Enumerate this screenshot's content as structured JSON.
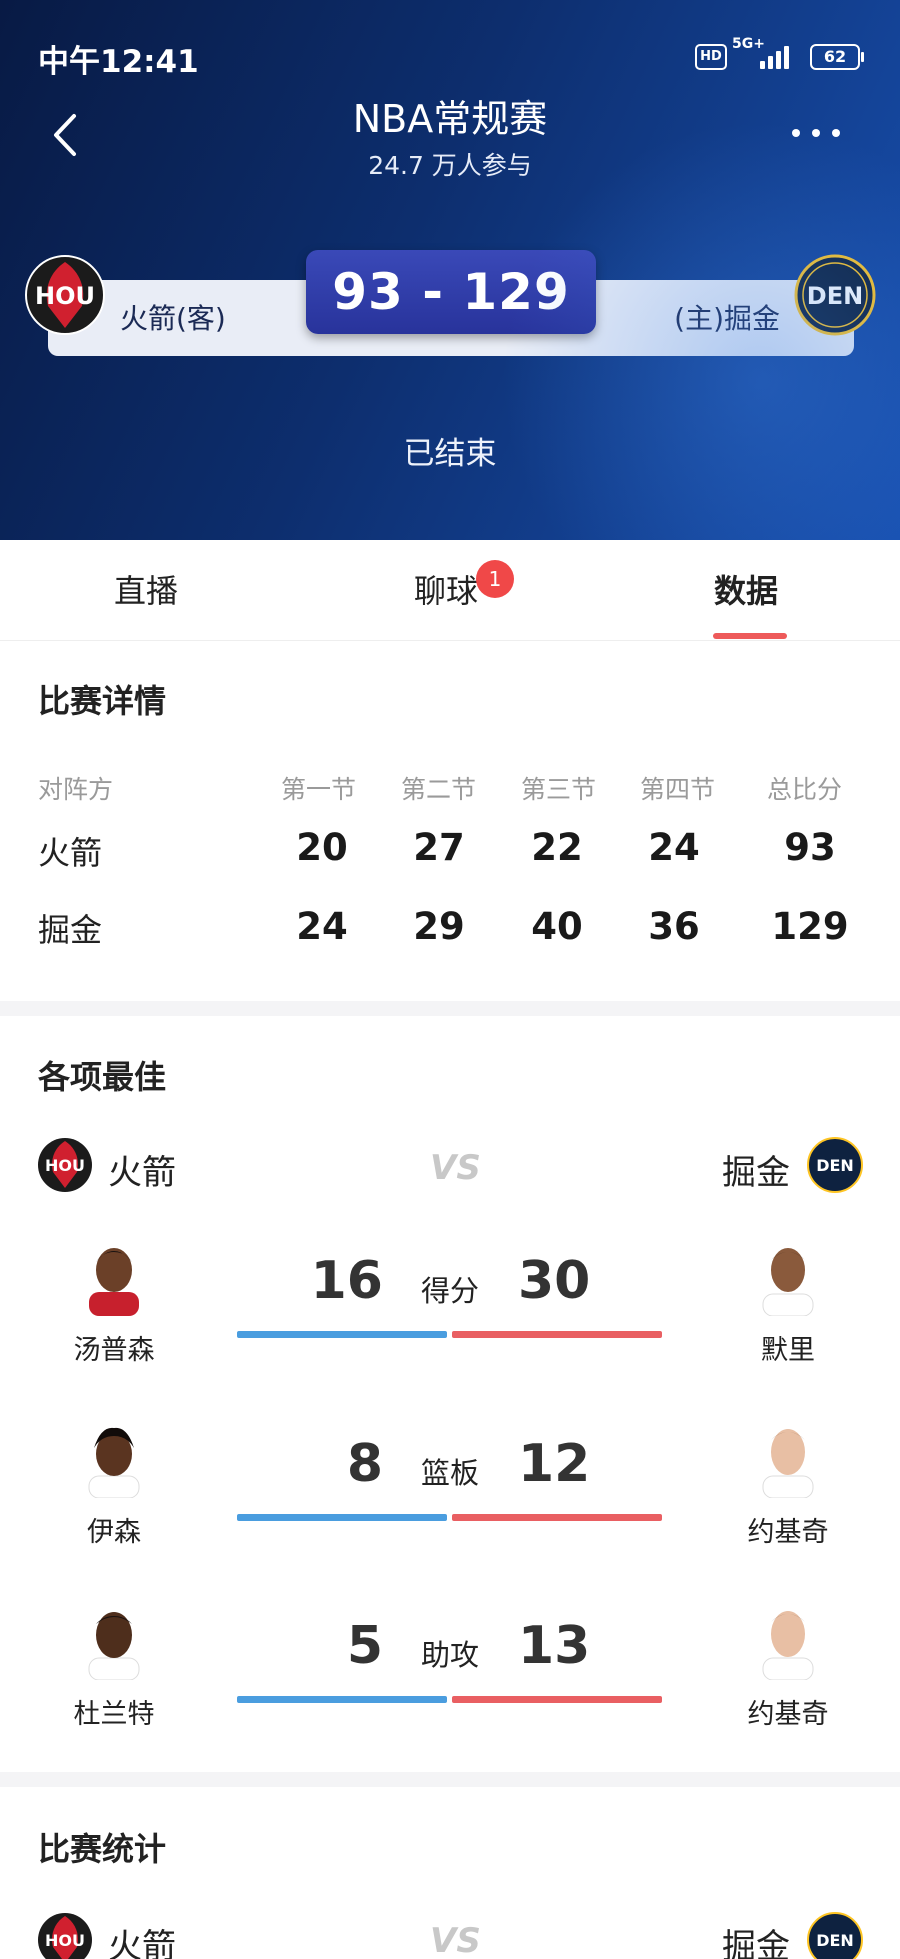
{
  "status_bar": {
    "time": "中午12:41",
    "hd": "HD",
    "network": "5G+",
    "battery": "62"
  },
  "header": {
    "title": "NBA常规赛",
    "participants": "24.7 万人参与",
    "score": "93 - 129",
    "away_team": {
      "abbr": "HOU",
      "label": "火箭(客)"
    },
    "home_team": {
      "abbr": "DEN",
      "label": "(主)掘金"
    },
    "status": "已结束"
  },
  "tabs": [
    {
      "label": "直播"
    },
    {
      "label": "聊球",
      "badge": "1"
    },
    {
      "label": "数据",
      "active": true
    }
  ],
  "match_detail": {
    "title": "比赛详情",
    "headers": [
      "对阵方",
      "第一节",
      "第二节",
      "第三节",
      "第四节",
      "总比分"
    ],
    "rows": [
      {
        "team": "火箭",
        "scores": [
          "20",
          "27",
          "22",
          "24",
          "93"
        ]
      },
      {
        "team": "掘金",
        "scores": [
          "24",
          "29",
          "40",
          "36",
          "129"
        ]
      }
    ]
  },
  "leaders": {
    "title": "各项最佳",
    "left_team": "火箭",
    "right_team": "掘金",
    "vs": "VS",
    "items": [
      {
        "category": "得分",
        "left_player": "汤普森",
        "left_value": "16",
        "right_player": "默里",
        "right_value": "30"
      },
      {
        "category": "篮板",
        "left_player": "伊森",
        "left_value": "8",
        "right_player": "约基奇",
        "right_value": "12"
      },
      {
        "category": "助攻",
        "left_player": "杜兰特",
        "left_value": "5",
        "right_player": "约基奇",
        "right_value": "13"
      }
    ]
  },
  "game_stats": {
    "title": "比赛统计",
    "left_team": "火箭",
    "right_team": "掘金",
    "vs": "VS"
  },
  "colors": {
    "accent_red": "#ee5a5a",
    "bar_blue": "#4a9ddf",
    "bar_red": "#e95f62",
    "score_box": "#2f3cab"
  }
}
